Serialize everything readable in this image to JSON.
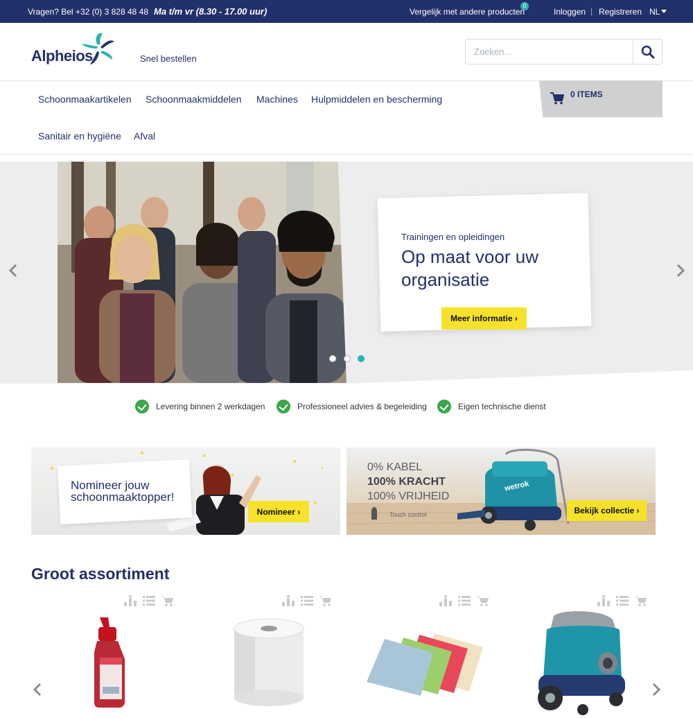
{
  "topbar": {
    "phone": "Vragen? Bel +32 (0) 3 828 48 48",
    "hours": "Ma t/m vr (8.30 - 17.00 uur)",
    "compare": "Vergelijk met andere producten",
    "compare_count": "0",
    "login": "Inloggen",
    "separator": "|",
    "register": "Registreren",
    "language": "NL"
  },
  "header": {
    "logo_text": "Alpheios",
    "quick_order": "Snel bestellen",
    "search_placeholder": "Zoeken..."
  },
  "nav": {
    "items": [
      "Schoonmaakartikelen",
      "Schoonmaakmiddelen",
      "Machines",
      "Hulpmiddelen en bescherming",
      "Sanitair en hygiëne",
      "Afval"
    ]
  },
  "cart": {
    "label": "0 ITEMS"
  },
  "hero": {
    "kicker": "Trainingen en opleidingen",
    "title": "Op maat voor uw organisatie",
    "cta": "Meer informatie ›",
    "active_slide": 3,
    "slide_count": 3
  },
  "usps": [
    "Levering binnen 2 werkdagen",
    "Professioneel advies & begeleiding",
    "Eigen technische dienst"
  ],
  "banners": {
    "left": {
      "text": "Nomineer jouw schoonmaaktopper!",
      "cta": "Nomineer ›"
    },
    "right": {
      "line1": "0% KABEL",
      "line2": "100% KRACHT",
      "line3": "100% VRIJHEID",
      "touch": "Touch control",
      "brand": "wetrok",
      "cta": "Bekijk collectie ›"
    }
  },
  "assortment": {
    "title": "Groot assortiment"
  },
  "colors": {
    "navy": "#22306b",
    "teal": "#2bb3b1",
    "yellow": "#f6e22b",
    "green": "#3aa74a"
  }
}
